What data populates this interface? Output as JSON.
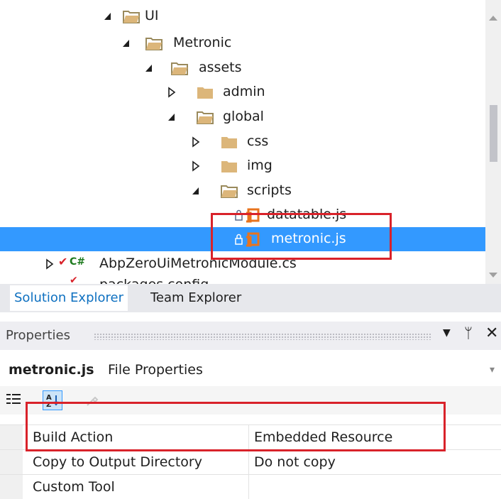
{
  "tree": {
    "items": [
      {
        "label": "UI",
        "expanded": true
      },
      {
        "label": "Metronic",
        "expanded": true
      },
      {
        "label": "assets",
        "expanded": true
      },
      {
        "label": "admin",
        "expanded": false
      },
      {
        "label": "global",
        "expanded": true
      },
      {
        "label": "css",
        "expanded": false
      },
      {
        "label": "img",
        "expanded": false
      },
      {
        "label": "scripts",
        "expanded": true
      },
      {
        "label": "datatable.js"
      },
      {
        "label": "metronic.js",
        "selected": true
      },
      {
        "label": "AbpZeroUiMetronicModule.cs",
        "prefix": "C#"
      },
      {
        "label": "packages.config"
      }
    ]
  },
  "tabs": {
    "solution_explorer": "Solution Explorer",
    "team_explorer": "Team Explorer"
  },
  "properties": {
    "title": "Properties",
    "object_name": "metronic.js",
    "object_type": "File Properties",
    "rows": [
      {
        "name": "Build Action",
        "value": "Embedded Resource"
      },
      {
        "name": "Copy to Output Directory",
        "value": "Do not copy"
      },
      {
        "name": "Custom Tool",
        "value": ""
      }
    ]
  },
  "colors": {
    "selection": "#3399ff",
    "highlight_box": "#d9222a",
    "folder": "#dcb67a",
    "js_file": "#e8741e"
  }
}
